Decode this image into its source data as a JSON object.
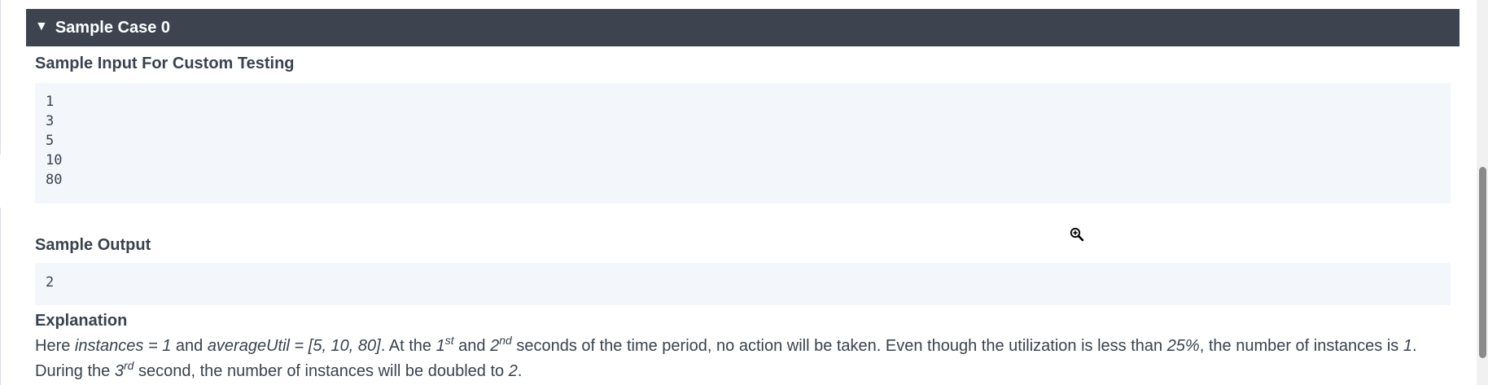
{
  "sample_case": {
    "header_label": "Sample Case 0",
    "expand_icon": "triangle-down-icon",
    "input_title": "Sample Input For Custom Testing",
    "input_lines": [
      "1",
      "3",
      "5",
      "10",
      "80"
    ],
    "output_title": "Sample Output",
    "output_lines": [
      "2"
    ],
    "explanation_title": "Explanation",
    "explanation": {
      "p1": "Here ",
      "v_instances": "instances = 1",
      "p2": " and ",
      "v_avg": "averageUtil = [5, 10, 80]",
      "p3": ".  At the ",
      "n1": "1",
      "s1": "st",
      "p4": " and ",
      "n2": "2",
      "s2": "nd",
      "p5": " seconds of the time period,  no action will be taken. Even though the utilization is less than ",
      "v_pct": "25%",
      "p6": ", the number of instances is ",
      "v_one": "1",
      "p7": ". During the ",
      "n3": "3",
      "s3": "rd",
      "p8": " second, the number of instances will be doubled to ",
      "v_two": "2",
      "p9": "."
    }
  },
  "cursor": {
    "icon": "zoom-in-icon"
  },
  "colors": {
    "header_bg": "#3d4450",
    "header_text": "#ffffff",
    "code_bg": "#f3f7fc",
    "body_text": "#39424e",
    "scrollbar_thumb": "#8a8a8a"
  }
}
